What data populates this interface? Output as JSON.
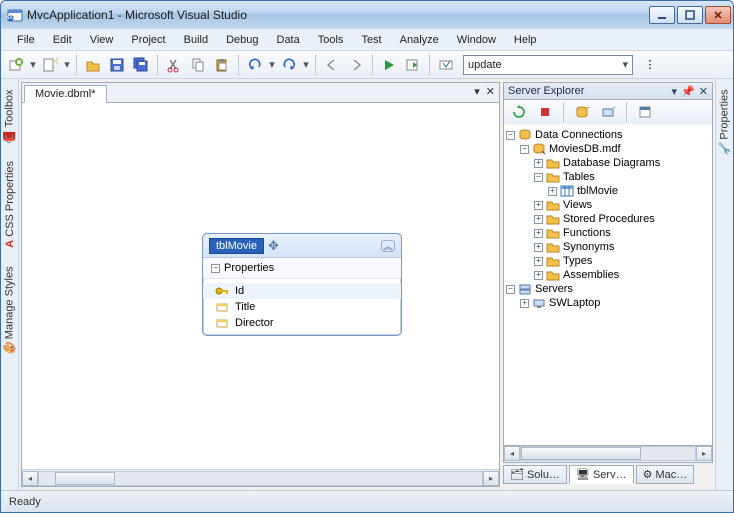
{
  "window": {
    "title": "MvcApplication1 - Microsoft Visual Studio"
  },
  "menu": {
    "items": [
      "File",
      "Edit",
      "View",
      "Project",
      "Build",
      "Debug",
      "Data",
      "Tools",
      "Test",
      "Analyze",
      "Window",
      "Help"
    ]
  },
  "toolbar": {
    "update_value": "update"
  },
  "document": {
    "tab_label": "Movie.dbml*"
  },
  "entity": {
    "title": "tblMovie",
    "section": "Properties",
    "props": [
      {
        "name": "Id",
        "is_key": true
      },
      {
        "name": "Title",
        "is_key": false
      },
      {
        "name": "Director",
        "is_key": false
      }
    ]
  },
  "server_explorer": {
    "title": "Server Explorer",
    "tree": {
      "data_connections": "Data Connections",
      "db": "MoviesDB.mdf",
      "nodes": {
        "diagrams": "Database Diagrams",
        "tables": "Tables",
        "table_item": "tblMovie",
        "views": "Views",
        "sprocs": "Stored Procedures",
        "functions": "Functions",
        "synonyms": "Synonyms",
        "types": "Types",
        "assemblies": "Assemblies"
      },
      "servers": "Servers",
      "server_item": "SWLaptop"
    },
    "tabs": {
      "solution": "Solu…",
      "server": "Serv…",
      "macro": "Mac…"
    }
  },
  "left_rail": {
    "toolbox": "Toolbox",
    "css": "CSS Properties",
    "manage": "Manage Styles"
  },
  "right_rail": {
    "properties": "Properties"
  },
  "status": {
    "text": "Ready"
  }
}
